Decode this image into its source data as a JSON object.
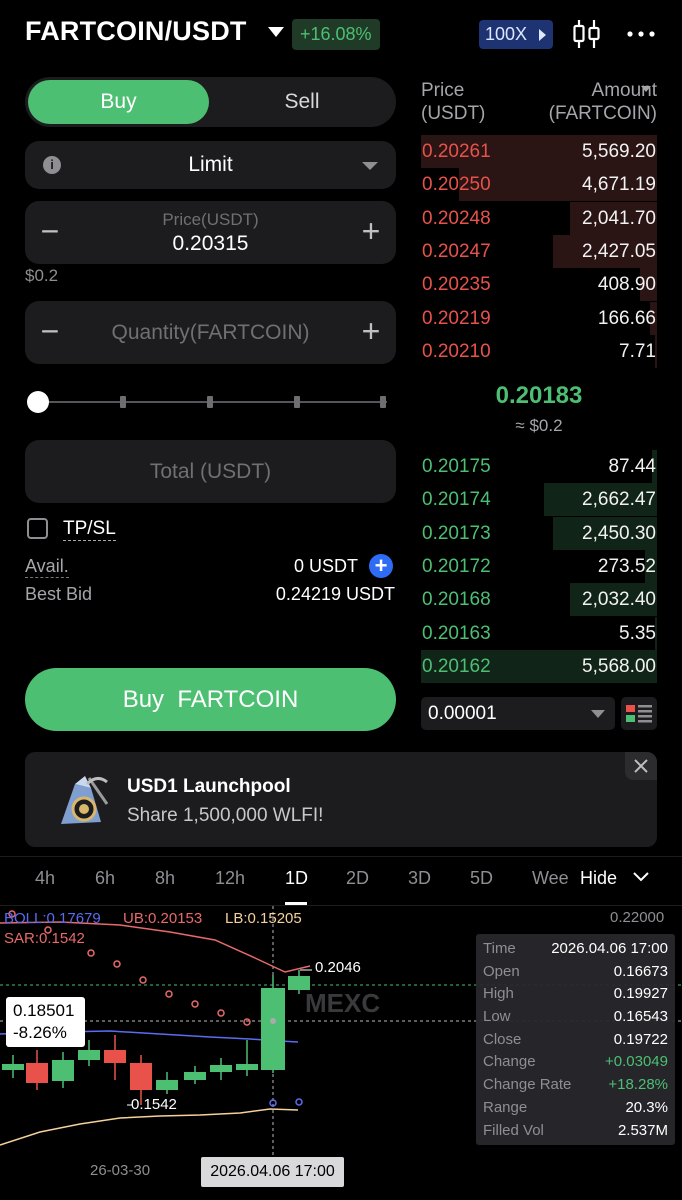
{
  "header": {
    "pair": "FARTCOIN/USDT",
    "change": "+16.08%",
    "leverage": "100X",
    "icons": [
      "chevron-down-icon",
      "candlestick-chart-icon",
      "more-icon"
    ]
  },
  "trade": {
    "buy_label": "Buy",
    "sell_label": "Sell",
    "order_type": "Limit",
    "price_label": "Price(USDT)",
    "price_value": "0.20315",
    "minus": "−",
    "plus": "+",
    "usd_hint": "$0.2",
    "quantity_label": "Quantity(FARTCOIN)",
    "total_label": "Total (USDT)",
    "tpsl_label": "TP/SL",
    "avail_label": "Avail.",
    "avail_value": "0 USDT",
    "best_bid_label": "Best Bid",
    "best_bid_value": "0.24219 USDT",
    "buy_button": "Buy  FARTCOIN"
  },
  "orderbook": {
    "price_header": "Price\n(USDT)",
    "amount_header": "Amount\n(FARTCOIN)",
    "asks": [
      {
        "price": "0.20261",
        "amount": "5,569.20",
        "depth": 1.0
      },
      {
        "price": "0.20250",
        "amount": "4,671.19",
        "depth": 0.84
      },
      {
        "price": "0.20248",
        "amount": "2,041.70",
        "depth": 0.37
      },
      {
        "price": "0.20247",
        "amount": "2,427.05",
        "depth": 0.44
      },
      {
        "price": "0.20235",
        "amount": "408.90",
        "depth": 0.07
      },
      {
        "price": "0.20219",
        "amount": "166.66",
        "depth": 0.03
      },
      {
        "price": "0.20210",
        "amount": "7.71",
        "depth": 0.01
      }
    ],
    "mid_price": "0.20183",
    "mid_usd": "≈ $0.2",
    "bids": [
      {
        "price": "0.20175",
        "amount": "87.44",
        "depth": 0.02
      },
      {
        "price": "0.20174",
        "amount": "2,662.47",
        "depth": 0.48
      },
      {
        "price": "0.20173",
        "amount": "2,450.30",
        "depth": 0.44
      },
      {
        "price": "0.20172",
        "amount": "273.52",
        "depth": 0.05
      },
      {
        "price": "0.20168",
        "amount": "2,032.40",
        "depth": 0.37
      },
      {
        "price": "0.20163",
        "amount": "5.35",
        "depth": 0.01
      },
      {
        "price": "0.20162",
        "amount": "5,568.00",
        "depth": 1.0
      }
    ],
    "step": "0.00001"
  },
  "banner": {
    "title": "USD1 Launchpool",
    "subtitle": "Share 1,500,000 WLFI!"
  },
  "chart": {
    "timeframes": [
      "4h",
      "6h",
      "8h",
      "12h",
      "1D",
      "2D",
      "3D",
      "5D",
      "Wee"
    ],
    "active_timeframe": "1D",
    "hide_label": "Hide",
    "boll": "BOLL:0.17679",
    "ub": "UB:0.20153",
    "lb": "LB:0.15205",
    "sar": "SAR:0.1542",
    "price_top": "0.22000",
    "cross_price": "0.18501",
    "cross_pct": "-8.26%",
    "cross_time": "2026.04.06 17:00",
    "date_label": "26-03-30",
    "high_mark": "0.2046",
    "low_mark": "0.1542",
    "colors": {
      "up": "#4dbf73",
      "down": "#e8524a",
      "boll": "#5b6cf0",
      "ub": "#e86a6a",
      "lb": "#f5d29b"
    },
    "tooltip": [
      {
        "k": "Time",
        "v": "2026.04.06 17:00"
      },
      {
        "k": "Open",
        "v": "0.16673"
      },
      {
        "k": "High",
        "v": "0.19927"
      },
      {
        "k": "Low",
        "v": "0.16543"
      },
      {
        "k": "Close",
        "v": "0.19722"
      },
      {
        "k": "Change",
        "v": "+0.03049",
        "color": "green"
      },
      {
        "k": "Change Rate",
        "v": "+18.28%",
        "color": "green"
      },
      {
        "k": "Range",
        "v": "20.3%"
      },
      {
        "k": "Filled Vol",
        "v": "2.537M"
      }
    ]
  }
}
